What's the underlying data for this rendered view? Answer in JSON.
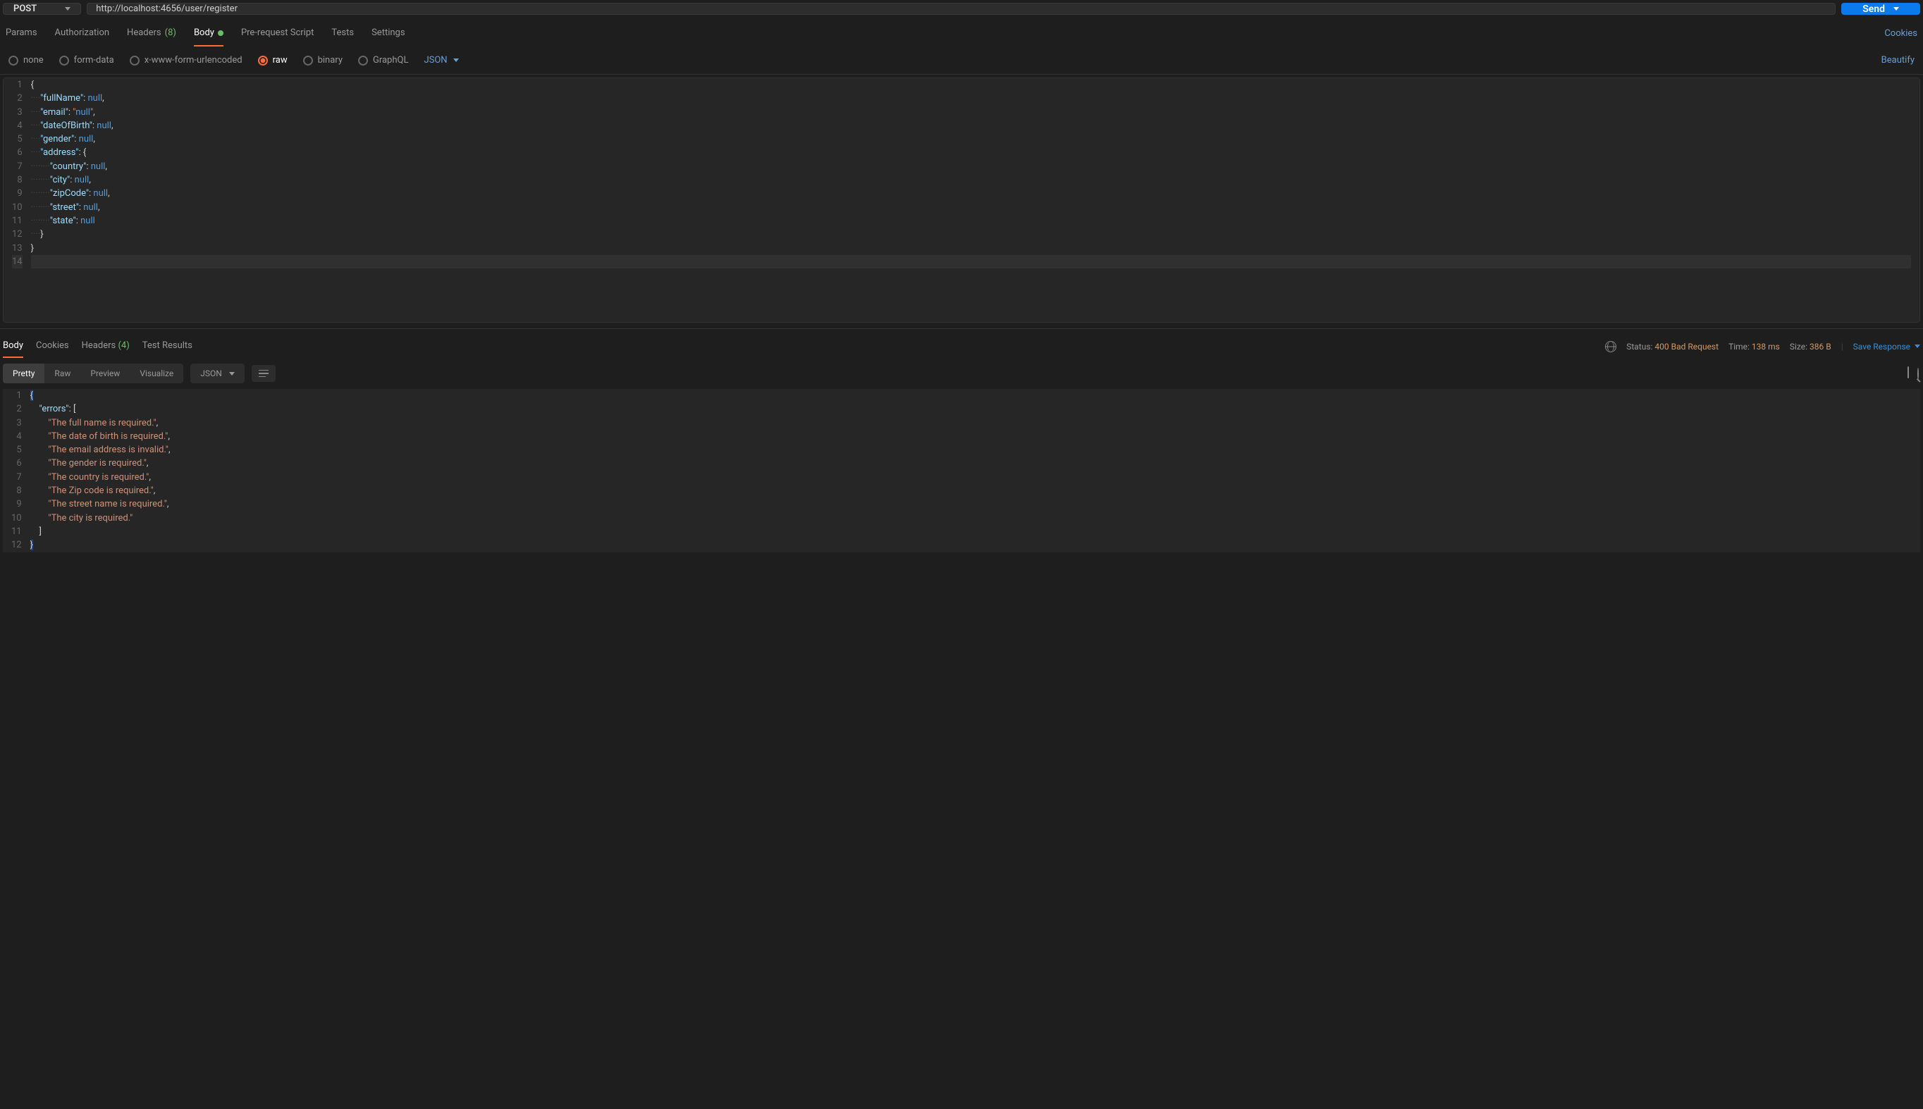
{
  "request": {
    "method": "POST",
    "url": "http://localhost:4656/user/register",
    "send_label": "Send"
  },
  "tabs": {
    "params": "Params",
    "authorization": "Authorization",
    "headers_label": "Headers",
    "headers_count": "(8)",
    "body": "Body",
    "prerequest": "Pre-request Script",
    "tests": "Tests",
    "settings": "Settings",
    "cookies_link": "Cookies"
  },
  "body_types": {
    "none": "none",
    "formdata": "form-data",
    "urlencoded": "x-www-form-urlencoded",
    "raw": "raw",
    "binary": "binary",
    "graphql": "GraphQL",
    "lang": "JSON",
    "beautify": "Beautify"
  },
  "request_body_lines": [
    "{",
    "····\"fullName\": null,",
    "····\"email\": \"null\",",
    "····\"dateOfBirth\": null,",
    "····\"gender\": null,",
    "····\"address\": {",
    "········\"country\": null,",
    "········\"city\": null,",
    "········\"zipCode\": null,",
    "········\"street\": null,",
    "········\"state\": null",
    "····}",
    "}",
    ""
  ],
  "response_tabs": {
    "body": "Body",
    "cookies": "Cookies",
    "headers_label": "Headers",
    "headers_count": "(4)",
    "test_results": "Test Results"
  },
  "response_meta": {
    "status_label": "Status:",
    "status_code": "400",
    "status_text": "Bad Request",
    "time_label": "Time:",
    "time_value": "138 ms",
    "size_label": "Size:",
    "size_value": "386 B",
    "save_response": "Save Response"
  },
  "view_options": {
    "pretty": "Pretty",
    "raw": "Raw",
    "preview": "Preview",
    "visualize": "Visualize",
    "lang": "JSON"
  },
  "response_body_lines": [
    "{",
    "    \"errors\": [",
    "        \"The full name is required.\",",
    "        \"The date of birth is required.\",",
    "        \"The email address is invalid.\",",
    "        \"The gender is required.\",",
    "        \"The country is required.\",",
    "        \"The Zip code is required.\",",
    "        \"The street name is required.\",",
    "        \"The city is required.\"",
    "    ]",
    "}"
  ]
}
